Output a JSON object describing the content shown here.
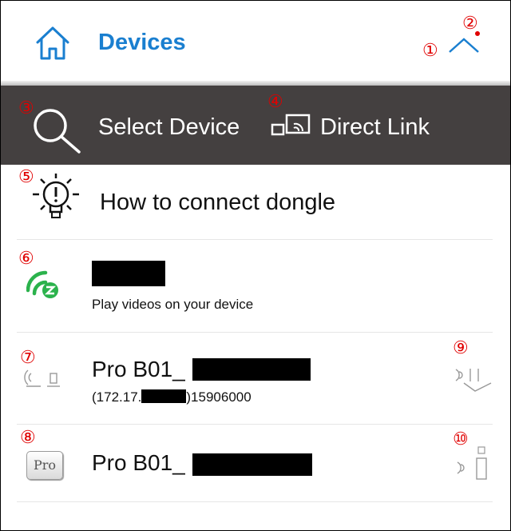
{
  "header": {
    "title": "Devices",
    "home_icon": "home-icon",
    "collapse_icon": "chevron-up-icon",
    "accent_color": "#1a7fd0"
  },
  "toolbar": {
    "select_device_label": "Select Device",
    "direct_link_label": "Direct Link",
    "background": "#444040"
  },
  "help": {
    "label": "How to connect dongle"
  },
  "app_entry": {
    "subtitle": "Play videos on your device"
  },
  "devices": [
    {
      "name": "Pro B01_",
      "ip_prefix": "(172.17.",
      "ip_suffix": ")15906000"
    },
    {
      "name": "Pro B01_"
    }
  ],
  "pro_badge": "Pro",
  "annotations": [
    "①",
    "②",
    "③",
    "④",
    "⑤",
    "⑥",
    "⑦",
    "⑧",
    "⑨",
    "⑩"
  ]
}
